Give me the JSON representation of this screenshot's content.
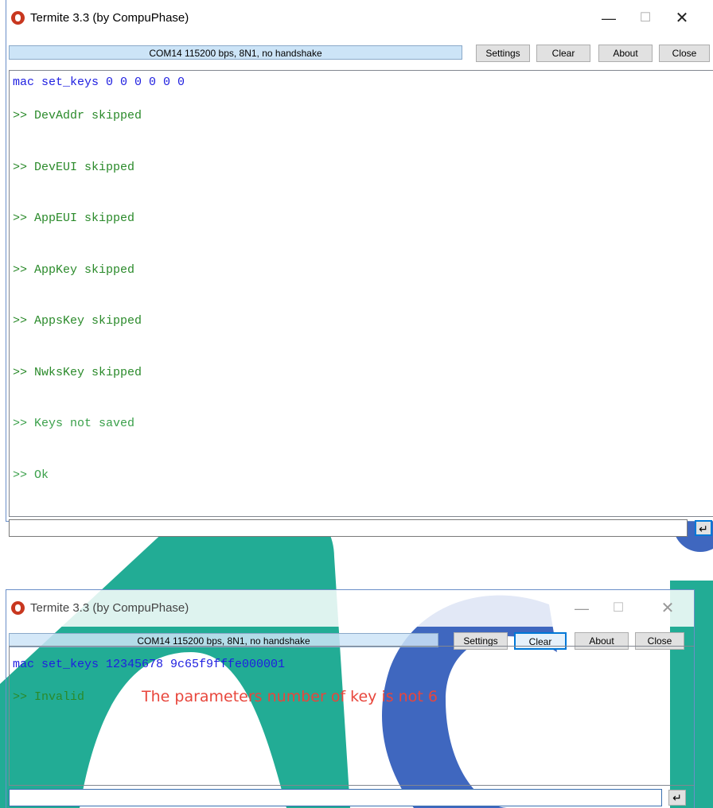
{
  "colors": {
    "watermark_teal": "#0aa38a",
    "watermark_blue": "#2a56b8",
    "annotation": "#e8463c",
    "command": "#1e1ee0",
    "response": "#2a8a2a"
  },
  "window1": {
    "title": "Termite 3.3 (by CompuPhase)",
    "status": "COM14 115200 bps, 8N1, no handshake",
    "buttons": {
      "settings": "Settings",
      "clear": "Clear",
      "about": "About",
      "close": "Close"
    },
    "controls": {
      "minimize": "—",
      "maximize": "☐",
      "close": "✕"
    },
    "output": [
      "mac set_keys 0 0 0 0 0 0",
      ">> DevAddr skipped",
      ">> DevEUI skipped",
      ">> AppEUI skipped",
      ">> AppKey skipped",
      ">> AppsKey skipped",
      ">> NwksKey skipped",
      ">> Keys not saved",
      ">> Ok"
    ],
    "input_value": "",
    "send_icon": "enter-arrow-icon"
  },
  "window2": {
    "title": "Termite 3.3 (by CompuPhase)",
    "status": "COM14 115200 bps, 8N1, no handshake",
    "buttons": {
      "settings": "Settings",
      "clear": "Clear",
      "about": "About",
      "close": "Close"
    },
    "controls": {
      "minimize": "—",
      "maximize": "☐",
      "close": "✕"
    },
    "output": [
      "mac set_keys 12345678 9c65f9fffe000001",
      ">> Invalid"
    ],
    "annotation": "The parameters number of key is not 6",
    "input_value": "",
    "send_icon": "enter-arrow-icon"
  }
}
